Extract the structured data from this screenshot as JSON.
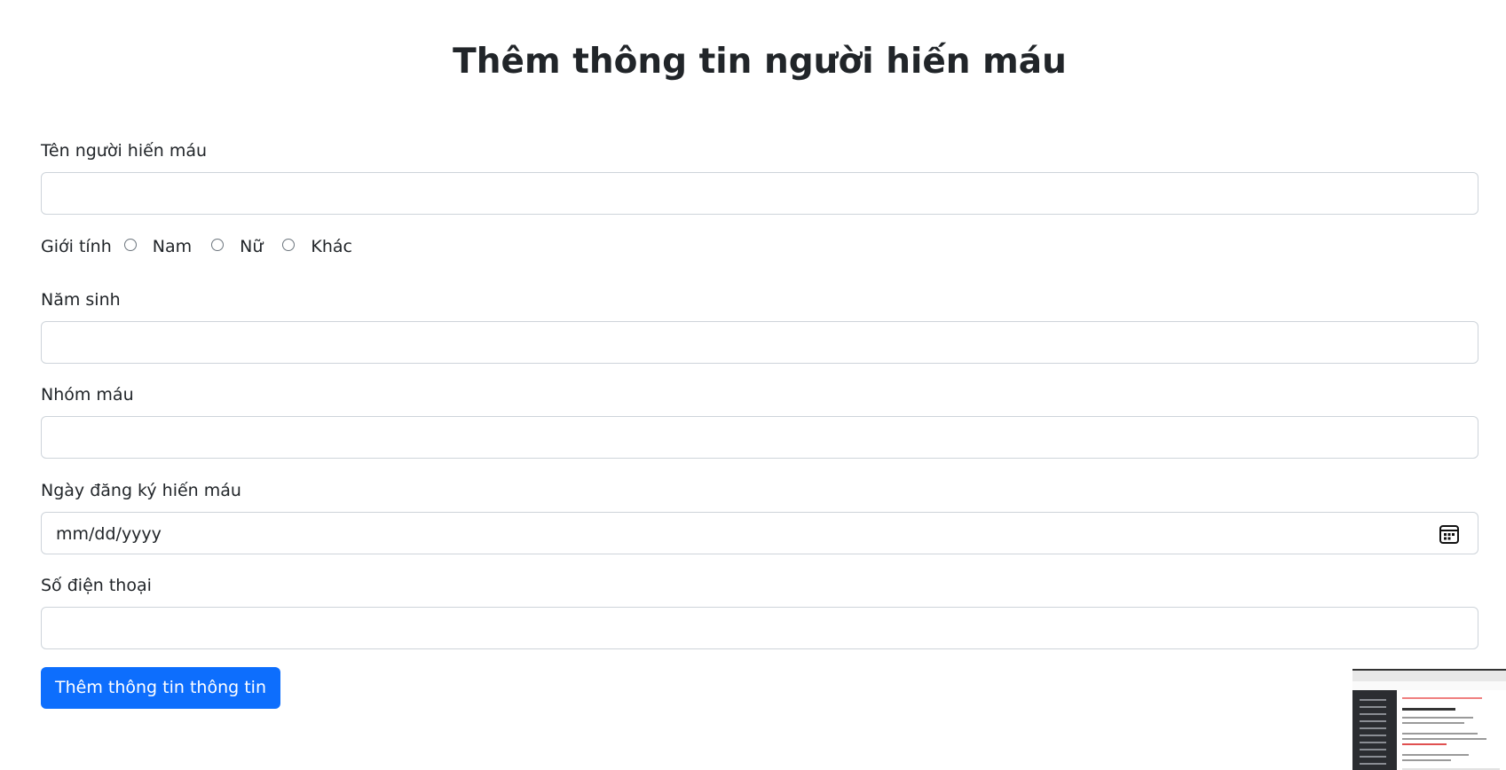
{
  "page": {
    "title": "Thêm thông tin người hiến máu"
  },
  "form": {
    "donor_name": {
      "label": "Tên người hiến máu",
      "value": ""
    },
    "gender": {
      "label": "Giới tính",
      "options": [
        "Nam",
        "Nữ",
        "Khác"
      ]
    },
    "birth_year": {
      "label": "Năm sinh",
      "value": ""
    },
    "blood_type": {
      "label": "Nhóm máu",
      "value": ""
    },
    "registration_date": {
      "label": "Ngày đăng ký hiến máu",
      "placeholder": "mm/dd/yyyy"
    },
    "phone": {
      "label": "Số điện thoại",
      "value": ""
    },
    "submit_label": "Thêm thông tin thông tin"
  },
  "colors": {
    "primary": "#0d6efd",
    "input_border": "#ced4da",
    "text": "#212529"
  },
  "icons": {
    "date_picker": "calendar-icon"
  }
}
